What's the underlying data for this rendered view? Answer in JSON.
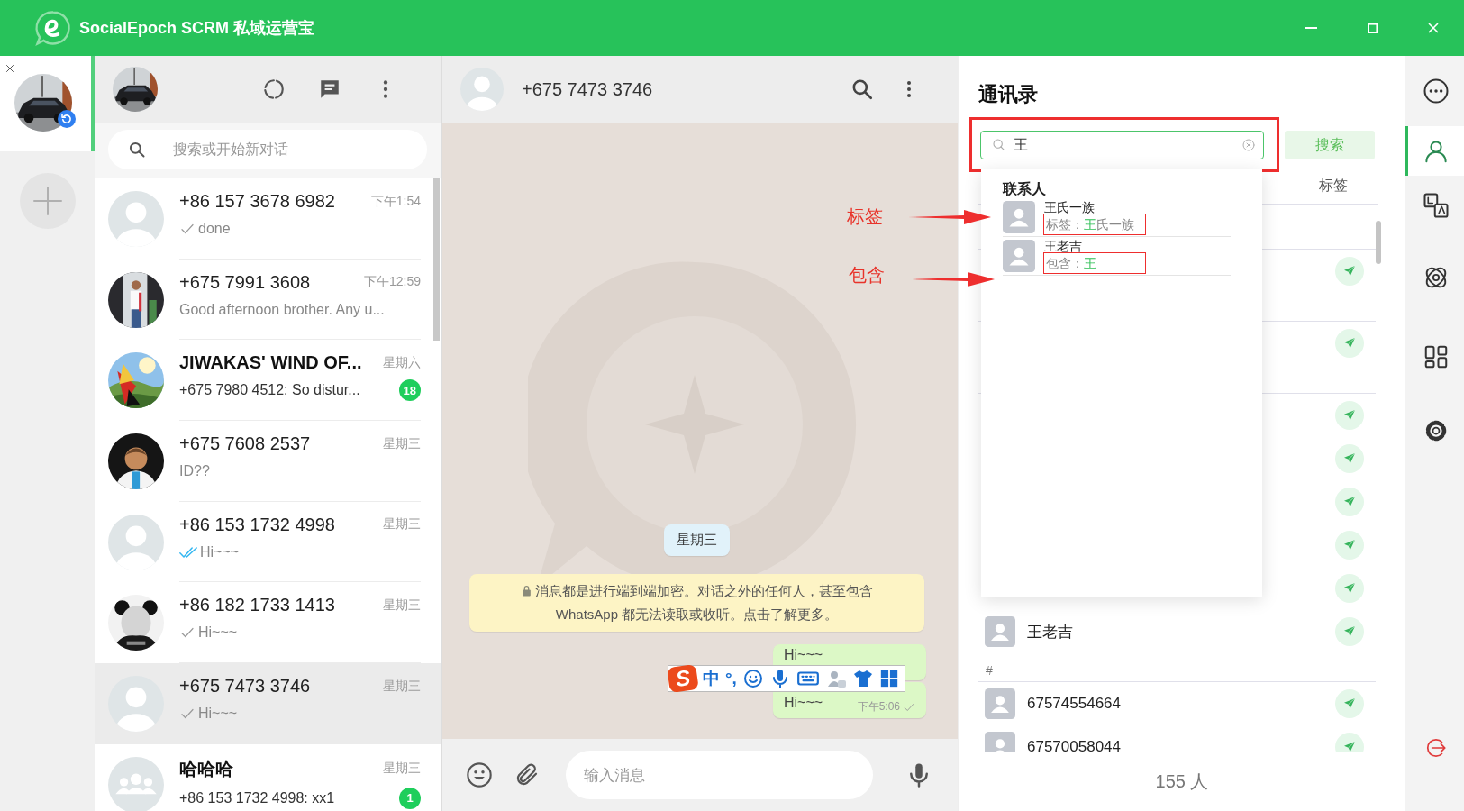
{
  "window": {
    "title": "SocialEpoch SCRM 私域运营宝"
  },
  "accounts": [
    {
      "selected": true
    }
  ],
  "chat_list": {
    "search_placeholder": "搜索或开始新对话",
    "chats": [
      {
        "kind": "default",
        "name": "+86 157 3678 6982",
        "time": "下午1:54",
        "sent": true,
        "read": false,
        "preview": "done",
        "selected": false
      },
      {
        "kind": "picture",
        "name": "+675 7991 3608",
        "time": "下午12:59",
        "sent": false,
        "read": false,
        "preview": "Good afternoon brother. Any u...",
        "selected": false
      },
      {
        "kind": "picture",
        "name": "JIWAKAS' WIND OF...",
        "time": "星期六",
        "sent": false,
        "read": false,
        "preview": "+675 7980 4512: So distur...",
        "badge": "18",
        "selected": false
      },
      {
        "kind": "picture",
        "name": "+675 7608 2537",
        "time": "星期三",
        "sent": false,
        "read": false,
        "preview": "ID??",
        "selected": false
      },
      {
        "kind": "default",
        "name": "+86 153 1732 4998",
        "time": "星期三",
        "sent": true,
        "read": true,
        "preview": "Hi~~~",
        "selected": false
      },
      {
        "kind": "picture",
        "name": "+86 182 1733 1413",
        "time": "星期三",
        "sent": true,
        "read": false,
        "preview": "Hi~~~",
        "selected": false
      },
      {
        "kind": "default",
        "name": "+675 7473 3746",
        "time": "星期三",
        "sent": true,
        "read": false,
        "preview": "Hi~~~",
        "selected": true
      },
      {
        "kind": "group",
        "name": "哈哈哈",
        "time": "星期三",
        "sent": false,
        "read": false,
        "preview": "+86 153 1732 4998: xx1",
        "badge": "1",
        "selected": false
      }
    ]
  },
  "chat": {
    "title": "+675 7473 3746",
    "date": "星期三",
    "notice": "消息都是进行端到端加密。对话之外的任何人，甚至包含 WhatsApp 都无法读取或收听。点击了解更多。",
    "messages": [
      {
        "text": "Hi~~~"
      },
      {
        "text": "Hi~~~",
        "time": "下午5:06",
        "sent": true
      }
    ],
    "input_placeholder": "输入消息"
  },
  "ime_toolbar": {
    "logo": "S",
    "mode": "中",
    "punctuation": "°,"
  },
  "contacts": {
    "title": "通讯录",
    "search": {
      "value": "王",
      "boxed": true
    },
    "search_button": "搜索",
    "tabs": [
      {
        "label": "标签",
        "selected": false
      }
    ],
    "list": [
      {
        "kind": "section"
      },
      {
        "kind": "covered"
      },
      {
        "kind": "section"
      },
      {
        "kind": "covered"
      },
      {
        "kind": "section"
      },
      {
        "kind": "covered"
      },
      {
        "kind": "covered"
      },
      {
        "kind": "covered"
      },
      {
        "kind": "covered"
      },
      {
        "kind": "covered"
      },
      {
        "kind": "contact",
        "name": "王老吉"
      },
      {
        "kind": "section",
        "label": "#"
      },
      {
        "kind": "contact",
        "name": "67574554664"
      },
      {
        "kind": "contact",
        "name": "67570058044"
      }
    ],
    "count": "155 人",
    "dropdown": {
      "header": "联系人",
      "results": [
        {
          "name": "王氏一族",
          "prefix": "标签：",
          "match": "王",
          "rest": "氏一族",
          "boxed": true
        },
        {
          "name": "王老吉",
          "prefix": "包含：",
          "match": "王",
          "boxed": true
        }
      ]
    }
  },
  "annotations": [
    {
      "label": "标签"
    },
    {
      "label": "包含"
    }
  ],
  "tool_rail": [
    {
      "kind": "more",
      "selected": false
    },
    {
      "kind": "contacts",
      "selected": true
    },
    {
      "kind": "translate",
      "selected": false
    },
    {
      "kind": "orbit",
      "selected": false
    },
    {
      "kind": "apps",
      "selected": false
    },
    {
      "kind": "settings",
      "selected": false
    },
    {
      "kind": "logout",
      "selected": false
    }
  ]
}
